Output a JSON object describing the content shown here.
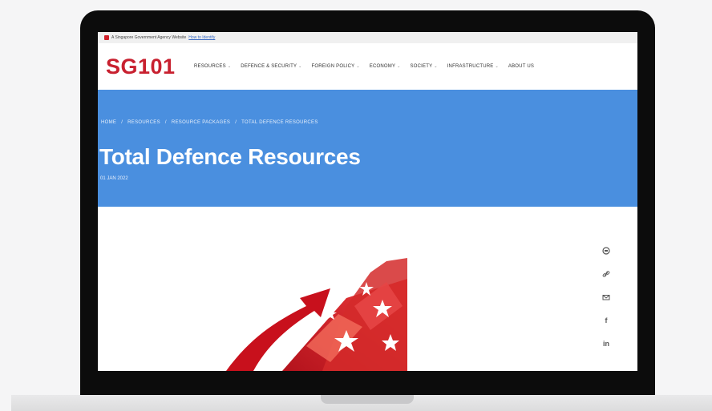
{
  "gov_bar": {
    "text": "A Singapore Government Agency Website",
    "link": "How to Identify"
  },
  "header": {
    "logo": "SG101",
    "nav": [
      {
        "label": "RESOURCES",
        "dropdown": true
      },
      {
        "label": "DEFENCE & SECURITY",
        "dropdown": true
      },
      {
        "label": "FOREIGN POLICY",
        "dropdown": true
      },
      {
        "label": "ECONOMY",
        "dropdown": true
      },
      {
        "label": "SOCIETY",
        "dropdown": true
      },
      {
        "label": "INFRASTRUCTURE",
        "dropdown": true
      },
      {
        "label": "ABOUT US",
        "dropdown": false
      }
    ]
  },
  "hero": {
    "breadcrumb": [
      "HOME",
      "/",
      "RESOURCES",
      "/",
      "RESOURCE PACKAGES",
      "/",
      "TOTAL DEFENCE RESOURCES"
    ],
    "title": "Total Defence Resources",
    "date": "01 JAN 2022"
  },
  "share": {
    "icons": [
      "print-icon",
      "link-icon",
      "email-icon",
      "facebook-icon",
      "linkedin-icon"
    ],
    "facebook_label": "f",
    "linkedin_label": "in"
  },
  "colors": {
    "brand_red": "#c8202f",
    "hero_blue": "#4a8fdf"
  }
}
